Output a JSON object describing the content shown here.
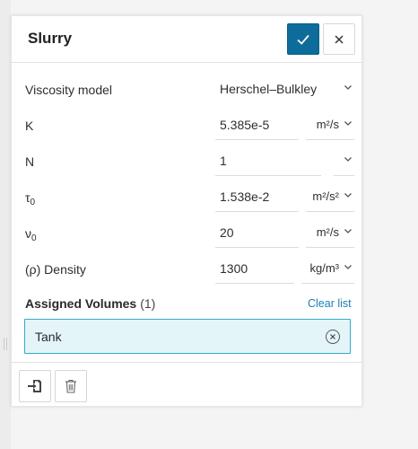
{
  "panel": {
    "title": "Slurry"
  },
  "properties": [
    {
      "label": "Viscosity model",
      "value": "Herschel–Bulkley",
      "unit": ""
    },
    {
      "label": "K",
      "value": "5.385e-5",
      "unit": "m²/s"
    },
    {
      "label": "N",
      "value": "1",
      "unit": ""
    },
    {
      "label_main": "τ",
      "label_sub": "0",
      "value": "1.538e-2",
      "unit": "m²/s²"
    },
    {
      "label_main": "ν",
      "label_sub": "0",
      "value": "20",
      "unit": "m²/s"
    },
    {
      "label": "(ρ) Density",
      "value": "1300",
      "unit": "kg/m³"
    }
  ],
  "assigned_volumes": {
    "title": "Assigned Volumes",
    "count": "(1)",
    "clear_label": "Clear list",
    "items": [
      "Tank"
    ]
  },
  "icons": {
    "confirm": "check-icon",
    "close": "close-icon",
    "assign": "assign-import-icon",
    "delete": "trash-icon",
    "dropdown": "chevron-down-icon",
    "remove": "remove-circle-x-icon"
  },
  "colors": {
    "accent": "#0d6c99",
    "link": "#1a7fb5",
    "volume_bg": "#e4f5f9",
    "volume_border": "#36a8c9"
  }
}
